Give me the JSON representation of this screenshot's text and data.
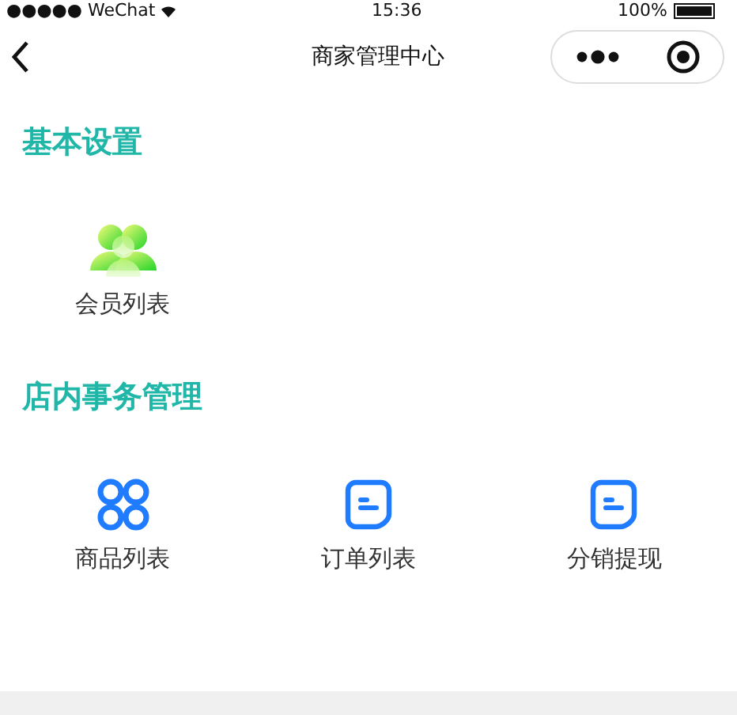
{
  "status_bar": {
    "carrier": "●●●●● WeChat",
    "time": "15:36",
    "battery": "100%"
  },
  "nav": {
    "title": "商家管理中心"
  },
  "sections": [
    {
      "title": "基本设置",
      "items": [
        {
          "label": "会员列表",
          "kind": "members"
        }
      ]
    },
    {
      "title": "店内事务管理",
      "items": [
        {
          "label": "商品列表",
          "kind": "grid"
        },
        {
          "label": "订单列表",
          "kind": "doc"
        },
        {
          "label": "分销提现",
          "kind": "doc"
        }
      ]
    }
  ]
}
